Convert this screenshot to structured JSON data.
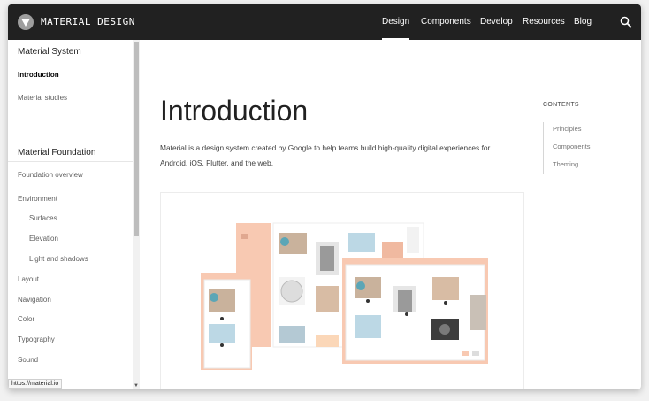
{
  "header": {
    "brand": "MATERIAL DESIGN",
    "nav": [
      "Design",
      "Components",
      "Develop",
      "Resources",
      "Blog"
    ],
    "active_nav": "Design"
  },
  "sidebar": {
    "section1_title": "Material System",
    "section1_items": [
      "Introduction",
      "Material studies"
    ],
    "section2_title": "Material Foundation",
    "section2_items": [
      "Foundation overview",
      "Environment",
      "Surfaces",
      "Elevation",
      "Light and shadows",
      "Layout",
      "Navigation",
      "Color",
      "Typography",
      "Sound"
    ]
  },
  "main": {
    "title": "Introduction",
    "intro": "Material is a design system created by Google to help teams build high-quality digital experiences for Android, iOS, Flutter, and the web."
  },
  "toc": {
    "title": "CONTENTS",
    "items": [
      "Principles",
      "Components",
      "Theming"
    ]
  },
  "status": {
    "url": "https://material.io"
  },
  "colors": {
    "topbar": "#212121",
    "accent_peach": "#f8c9b2"
  }
}
